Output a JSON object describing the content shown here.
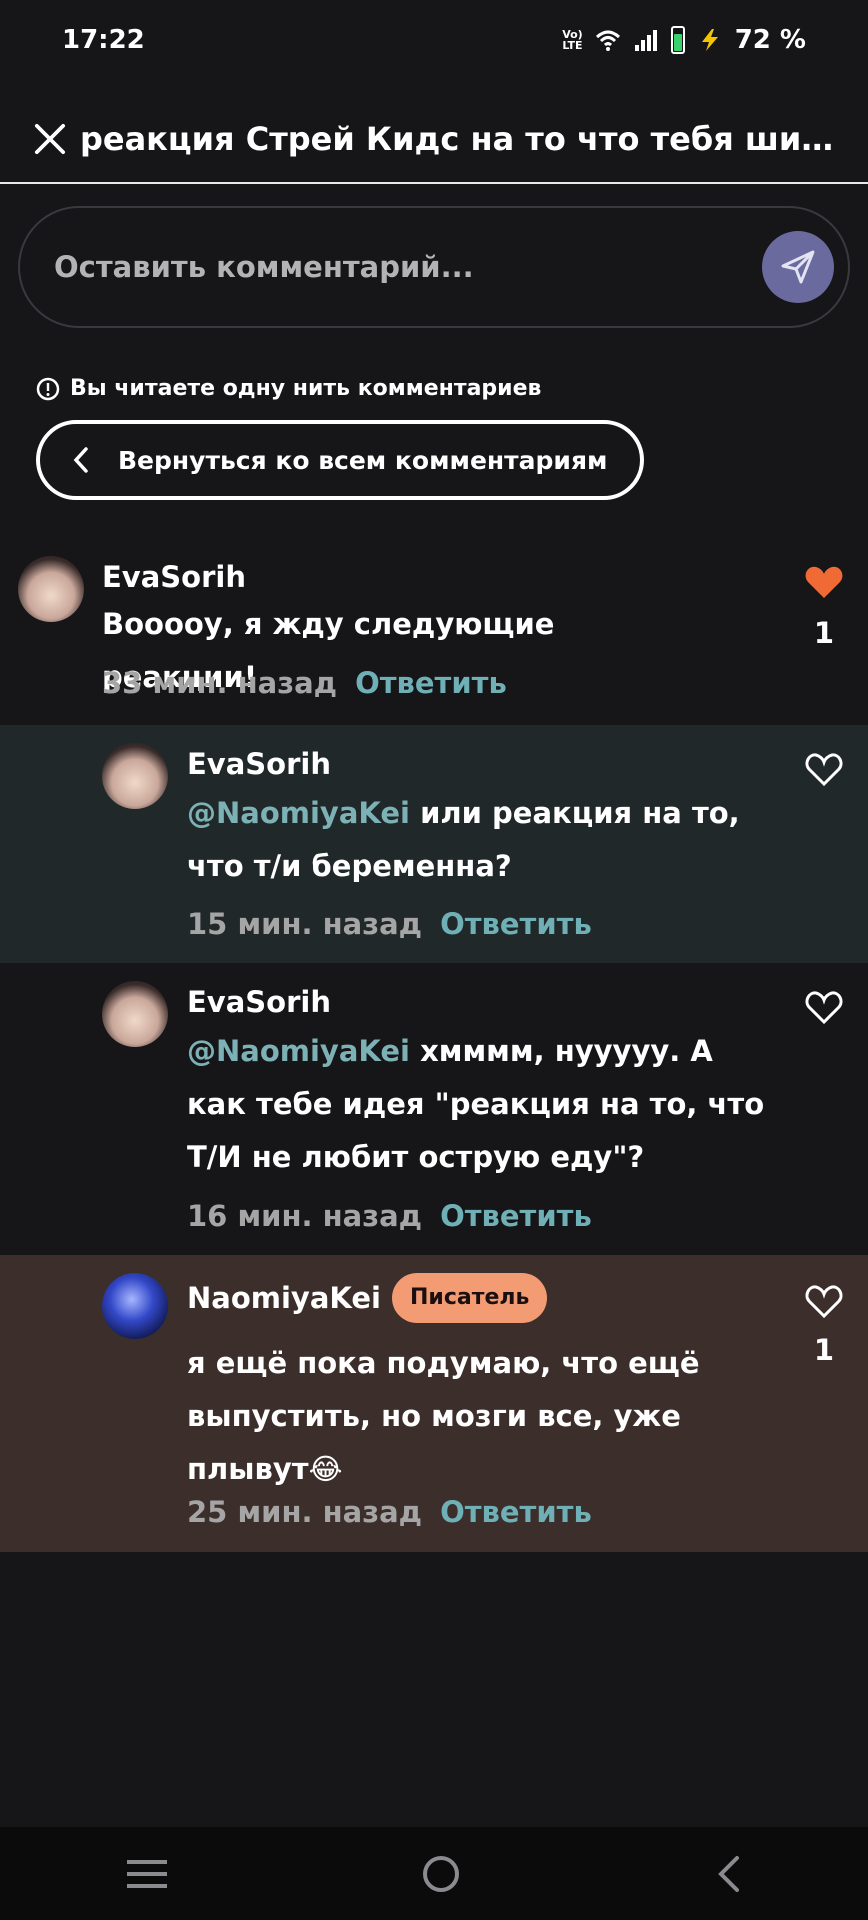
{
  "status": {
    "time": "17:22",
    "network_label": "Vo) LTE",
    "battery": "72 %"
  },
  "header": {
    "title": "реакция Стрей Кидс на то что тебя шипп..."
  },
  "comment_input": {
    "placeholder": "Оставить комментарий..."
  },
  "thread": {
    "note": "Вы читаете одну нить комментариев",
    "back_label": "Вернуться ко всем комментариям"
  },
  "comments": [
    {
      "username": "EvaSorih",
      "text": "Вооооу, я жду следующие реакции!",
      "time": "33 мин. назад",
      "reply": "Ответить",
      "likes": "1",
      "liked": true
    },
    {
      "username": "EvaSorih",
      "mention": "@NaomiyaKei",
      "text_line1": " или реакция на то,",
      "text_line2": "что т/и беременна?",
      "time": "15 мин. назад",
      "reply": "Ответить",
      "background": "#212829"
    },
    {
      "username": "EvaSorih",
      "mention": "@NaomiyaKei",
      "text_line1": " хмммм, нууууу. А",
      "text_line2": "как тебе идея \"реакция на то, что",
      "text_line3": "Т/И не любит острую еду\"?",
      "time": "16 мин. назад",
      "reply": "Ответить"
    },
    {
      "username": "NaomiyaKei",
      "badge": "Писатель",
      "text_line1": "я ещё пока подумаю, что ещё",
      "text_line2": "выпустить, но мозги все, уже",
      "text_line3": "плывут😂",
      "time": "25 мин. назад",
      "reply": "Ответить",
      "likes": "1",
      "background": "#3c2e2b"
    }
  ],
  "colors": {
    "accent_heart": "#f06a36",
    "reply_link": "#6fb0b6",
    "badge": "#f39b73"
  },
  "icons": [
    "close-icon",
    "send-icon",
    "info-icon",
    "chevron-left-icon",
    "heart-icon",
    "menu-icon",
    "home-icon",
    "back-icon"
  ]
}
